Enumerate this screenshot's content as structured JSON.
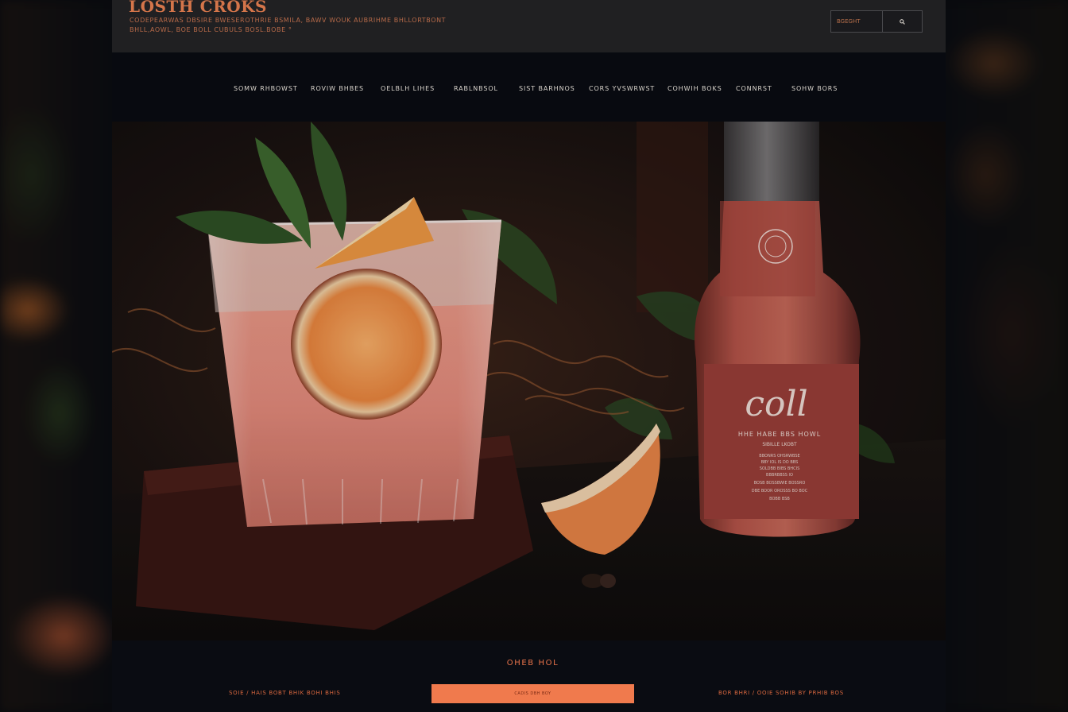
{
  "header": {
    "brand": "LOSTH CROKS",
    "tagline": "CODEPEARWAS DBSIRE BWESEROTHRIE BSMILA, BAWV WOUK AUBRIHME BHLLORTBONT BHLL,AOWL, BOE BOLL CUBULS BOSL.BOBE °",
    "search": {
      "placeholder": "BGEGHT",
      "icon": "search-icon"
    }
  },
  "nav": {
    "items": [
      {
        "label": "SOMW RHBOWST"
      },
      {
        "label": "ROVIW BHBES"
      },
      {
        "label": "OELBLH LIHES"
      },
      {
        "label": "RABLNBSOL"
      },
      {
        "label": "SIST BARHNOS"
      },
      {
        "label": "CORS YVSWRWST"
      },
      {
        "label": "COHWIH BOKS"
      },
      {
        "label": "CONNRST"
      },
      {
        "label": "SOHW BORS"
      }
    ]
  },
  "hero": {
    "bottle_label": {
      "logo": "coll",
      "heading": "HHE   HABE BBS   HOWL",
      "subheading": "SIBILLE LKOBT",
      "lines": [
        "BBONRS OHSRWBSE",
        "BBY IOL IS DO BBS",
        "SOLDBB BIBS BHCIS",
        "BBBRBBSS IO"
      ],
      "footer_lines": [
        "BOSB BOSSBWIE BOSSRO",
        "DBE BOOR OROSSS BO BOC",
        "BOBB BSB"
      ]
    }
  },
  "footer": {
    "title": "OHEB HOL",
    "left_text": "SOIE / HAIS BOBT BHIK BOHI BHIS",
    "right_text": "BOR BHRI / OOIE SOHIB BY PRHIB BOS",
    "cta_label": "CADIS DBH BOY"
  },
  "colors": {
    "accent": "#f07a4d",
    "brand": "#d4754a",
    "topbar_bg": "#202022",
    "nav_bg": "#080a10",
    "page_bg": "#0a0c12"
  }
}
